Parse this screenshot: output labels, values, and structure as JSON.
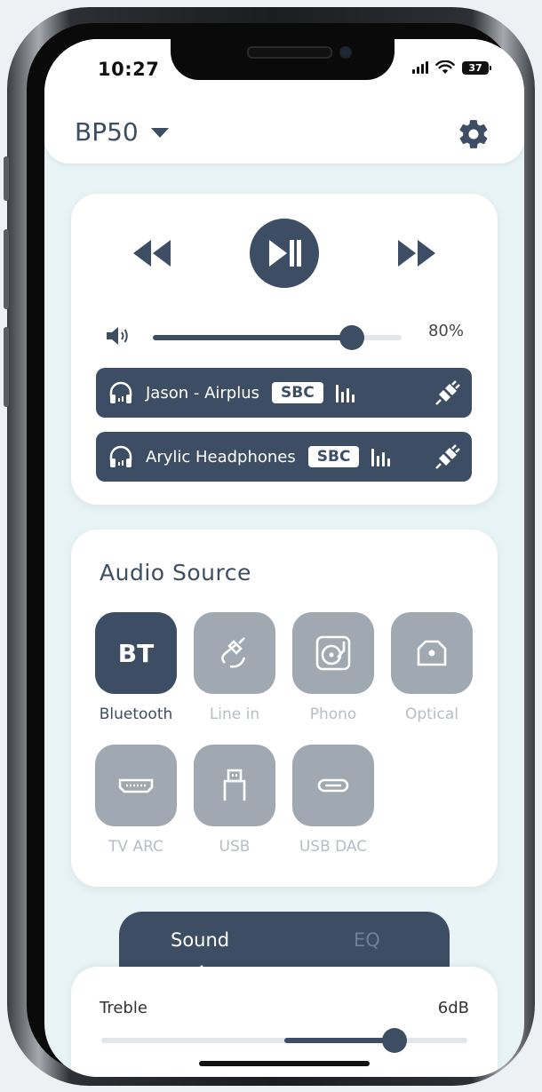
{
  "status_bar": {
    "time": "10:27",
    "battery": "37"
  },
  "header": {
    "device_name": "BP50"
  },
  "player": {
    "volume_percent_label": "80%",
    "volume_level": 0.8,
    "devices": [
      {
        "name": "Jason - Airplus",
        "codec": "SBC"
      },
      {
        "name": "Arylic Headphones",
        "codec": "SBC"
      }
    ]
  },
  "audio_source": {
    "title": "Audio Source",
    "bt_glyph": "BT",
    "items": [
      {
        "label": "Bluetooth",
        "icon": "bt-text-icon",
        "active": true
      },
      {
        "label": "Line in",
        "icon": "aux-cable-icon",
        "active": false
      },
      {
        "label": "Phono",
        "icon": "turntable-icon",
        "active": false
      },
      {
        "label": "Optical",
        "icon": "optical-port-icon",
        "active": false
      },
      {
        "label": "TV ARC",
        "icon": "hdmi-port-icon",
        "active": false
      },
      {
        "label": "USB",
        "icon": "usb-plug-icon",
        "active": false
      },
      {
        "label": "USB DAC",
        "icon": "usb-c-icon",
        "active": false
      }
    ]
  },
  "tabs": {
    "sound": "Sound",
    "eq": "EQ",
    "active": "Sound"
  },
  "sound": {
    "treble_label": "Treble",
    "treble_value": "6dB",
    "treble_level": 0.8
  },
  "colors": {
    "accent": "#3d4d63",
    "inactive_tile": "#a0a8b1",
    "background": "#e8f3f6"
  }
}
